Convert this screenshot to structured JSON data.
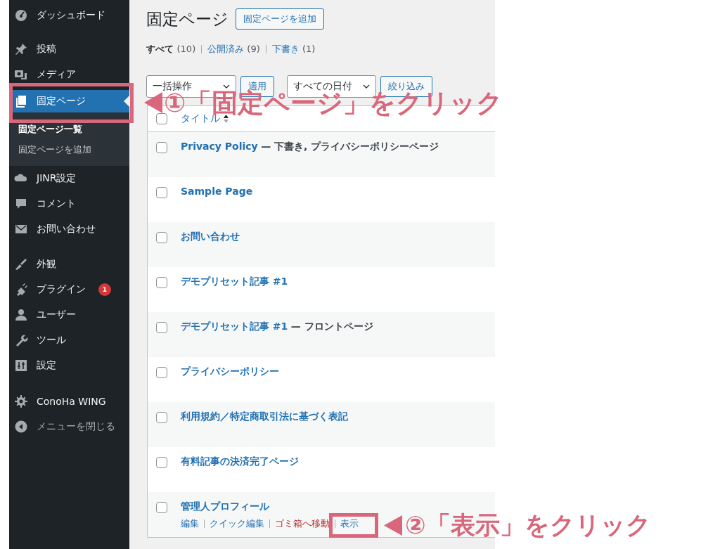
{
  "sidebar": {
    "sections": [
      {
        "items": [
          {
            "label": "ダッシュボード",
            "selected": false
          }
        ]
      },
      {
        "items": [
          {
            "label": "投稿",
            "selected": false
          },
          {
            "label": "メディア",
            "selected": false
          },
          {
            "label": "固定ページ",
            "selected": true,
            "children": [
              {
                "label": "固定ページ一覧",
                "selected": true
              },
              {
                "label": "固定ページを追加",
                "selected": false
              }
            ]
          },
          {
            "label": "JINR設定",
            "selected": false
          },
          {
            "label": "コメント",
            "selected": false
          },
          {
            "label": "お問い合わせ",
            "selected": false
          }
        ]
      },
      {
        "items": [
          {
            "label": "外観",
            "selected": false
          },
          {
            "label": "プラグイン",
            "selected": false,
            "badge": "1"
          },
          {
            "label": "ユーザー",
            "selected": false
          },
          {
            "label": "ツール",
            "selected": false
          },
          {
            "label": "設定",
            "selected": false
          }
        ]
      },
      {
        "items": [
          {
            "label": "ConoHa WING",
            "selected": false
          },
          {
            "label": "メニューを閉じる",
            "selected": false,
            "kind": "collapse"
          }
        ]
      }
    ]
  },
  "content": {
    "title": "固定ページ",
    "add_button": "固定ページを追加",
    "filters": [
      {
        "label": "すべて",
        "count": "(10)",
        "selected": true
      },
      {
        "label": "公開済み",
        "count": "(9)",
        "selected": false
      },
      {
        "label": "下書き",
        "count": "(1)",
        "selected": false
      }
    ],
    "bulk_action": "一括操作",
    "apply_button": "適用",
    "date_filter": "すべての日付",
    "filter_button": "絞り込み",
    "table": {
      "column": "タイトル",
      "header_checked": false,
      "rows": [
        {
          "title": "Privacy Policy",
          "state": "— 下書き, プライバシーポリシーページ",
          "checked": false
        },
        {
          "title": "Sample Page",
          "checked": false
        },
        {
          "title": "お問い合わせ",
          "checked": false
        },
        {
          "title": "デモプリセット記事 #1",
          "checked": false
        },
        {
          "title": "デモプリセット記事 #1",
          "state": "— フロントページ",
          "checked": false
        },
        {
          "title": "プライバシーポリシー",
          "checked": false
        },
        {
          "title": "利用規約／特定商取引法に基づく表記",
          "checked": false
        },
        {
          "title": "有料記事の決済完了ページ",
          "checked": false
        },
        {
          "title": "管理人プロフィール",
          "checked": false,
          "actions": [
            {
              "label": "編集",
              "kind": "link"
            },
            {
              "label": "クイック編集",
              "kind": "link"
            },
            {
              "label": "ゴミ箱へ移動",
              "kind": "delete"
            },
            {
              "label": "表示",
              "kind": "link"
            }
          ]
        }
      ]
    }
  },
  "annotations": [
    {
      "text": "①「固定ページ」をクリック"
    },
    {
      "text": "②「表示」をクリック"
    }
  ]
}
